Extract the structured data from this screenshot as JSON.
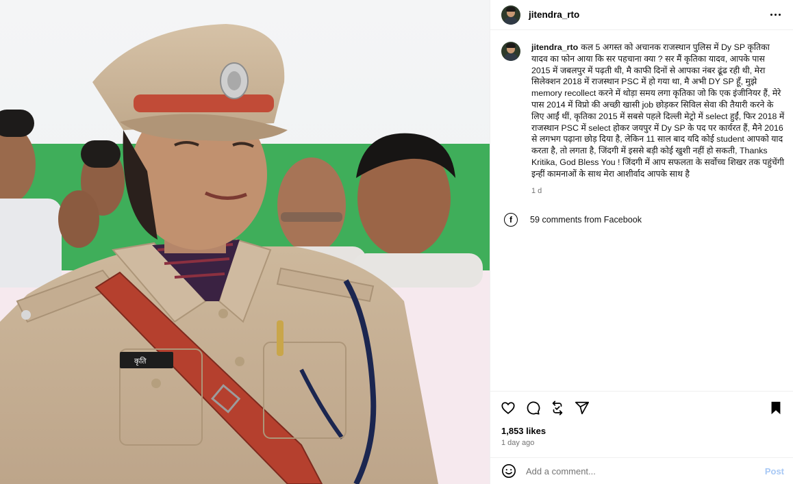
{
  "post": {
    "username": "jitendra_rto",
    "caption": "कल 5 अगस्त को अचानक राजस्थान पुलिस में Dy SP कृतिका यादव का फोन आया कि सर पहचाना क्या ? सर मैं कृतिका यादव, आपके पास 2015 में जबलपुर में पढ़ती थी, मै काफी दिनों से आपका नंबर ढूंढ रही थी, मेरा सिलेक्शन 2018 में राजस्थान PSC में हो गया था, मै अभी DY SP हूँ, मुझे memory recollect करने में थोड़ा समय लगा कृतिका जो कि एक इंजीनियर हैं, मेरे पास 2014 में विप्रो की अच्छी खासी job छोड़कर सिविल सेवा की तैयारी करने के लिए आईं थीं, कृतिका 2015 में सबसे पहले दिल्ली मेट्रो में select हुईं, फिर 2018 में राजस्थान PSC में select होकर जयपुर में Dy SP के पद पर कार्यरत हैं, मैने 2016 से लगभग पढ़ाना छोड़ दिया है, लेकिन 11 साल बाद यदि कोई student आपको याद करता है, तो लगता है, जिंदगी में इससे बड़ी कोई खुशी नहीं हो सकती, Thanks Kritika, God Bless You ! जिंदगी में आप सफलता के सर्वोच्च शिखर तक पहुंचेंगी इन्हीं कामनाओं के साथ मेरा आशीर्वाद आपके साथ है",
    "caption_age": "1 d",
    "facebook_comments": "59 comments from Facebook",
    "likes": "1,853 likes",
    "posted_ago": "1 day ago",
    "comment_placeholder": "Add a comment...",
    "post_label": "Post"
  },
  "icons": {
    "more": "more-options-icon",
    "like": "heart-icon",
    "comment": "comment-icon",
    "repost": "repost-icon",
    "share": "share-icon",
    "save": "bookmark-icon",
    "emoji": "emoji-icon",
    "facebook": "facebook-icon"
  },
  "photo": {
    "name_tag": "कृति"
  },
  "colors": {
    "post_button": "#a7c8f5",
    "muted_text": "#737373",
    "uniform": "#c8b49a",
    "belt": "#b5402e"
  }
}
